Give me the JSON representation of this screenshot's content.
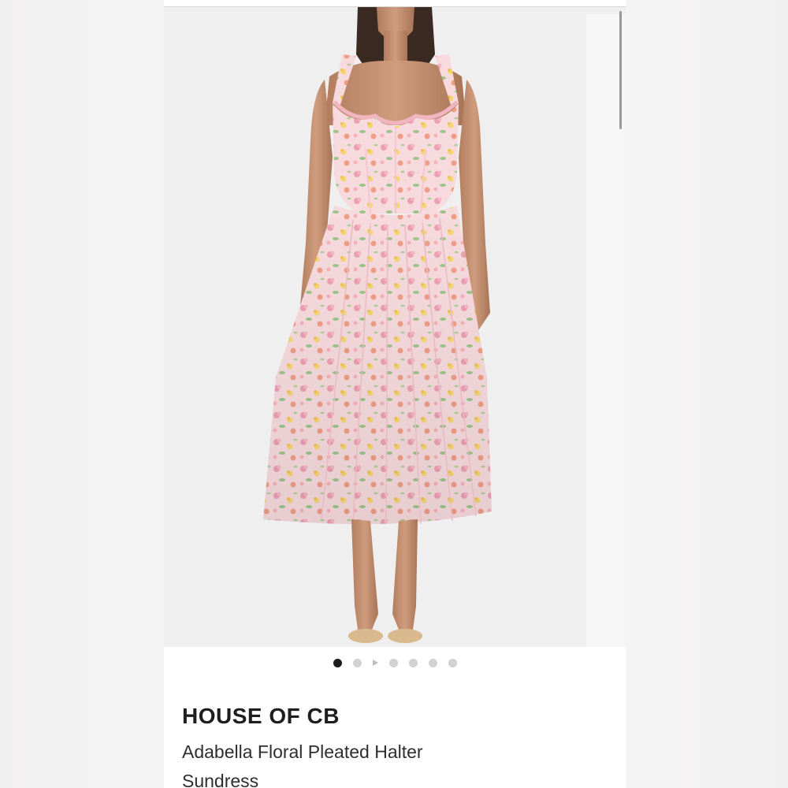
{
  "product": {
    "brand": "HOUSE OF CB",
    "name": "Adabella Floral Pleated Halter Sundress"
  },
  "gallery": {
    "image_count": 6,
    "active_index": 0,
    "has_video_indicator": true
  },
  "colors": {
    "dress_base": "#f6d9dc",
    "background": "#f0efef",
    "active_dot": "#1d1d1d",
    "inactive_dot": "#d2d2d2"
  }
}
